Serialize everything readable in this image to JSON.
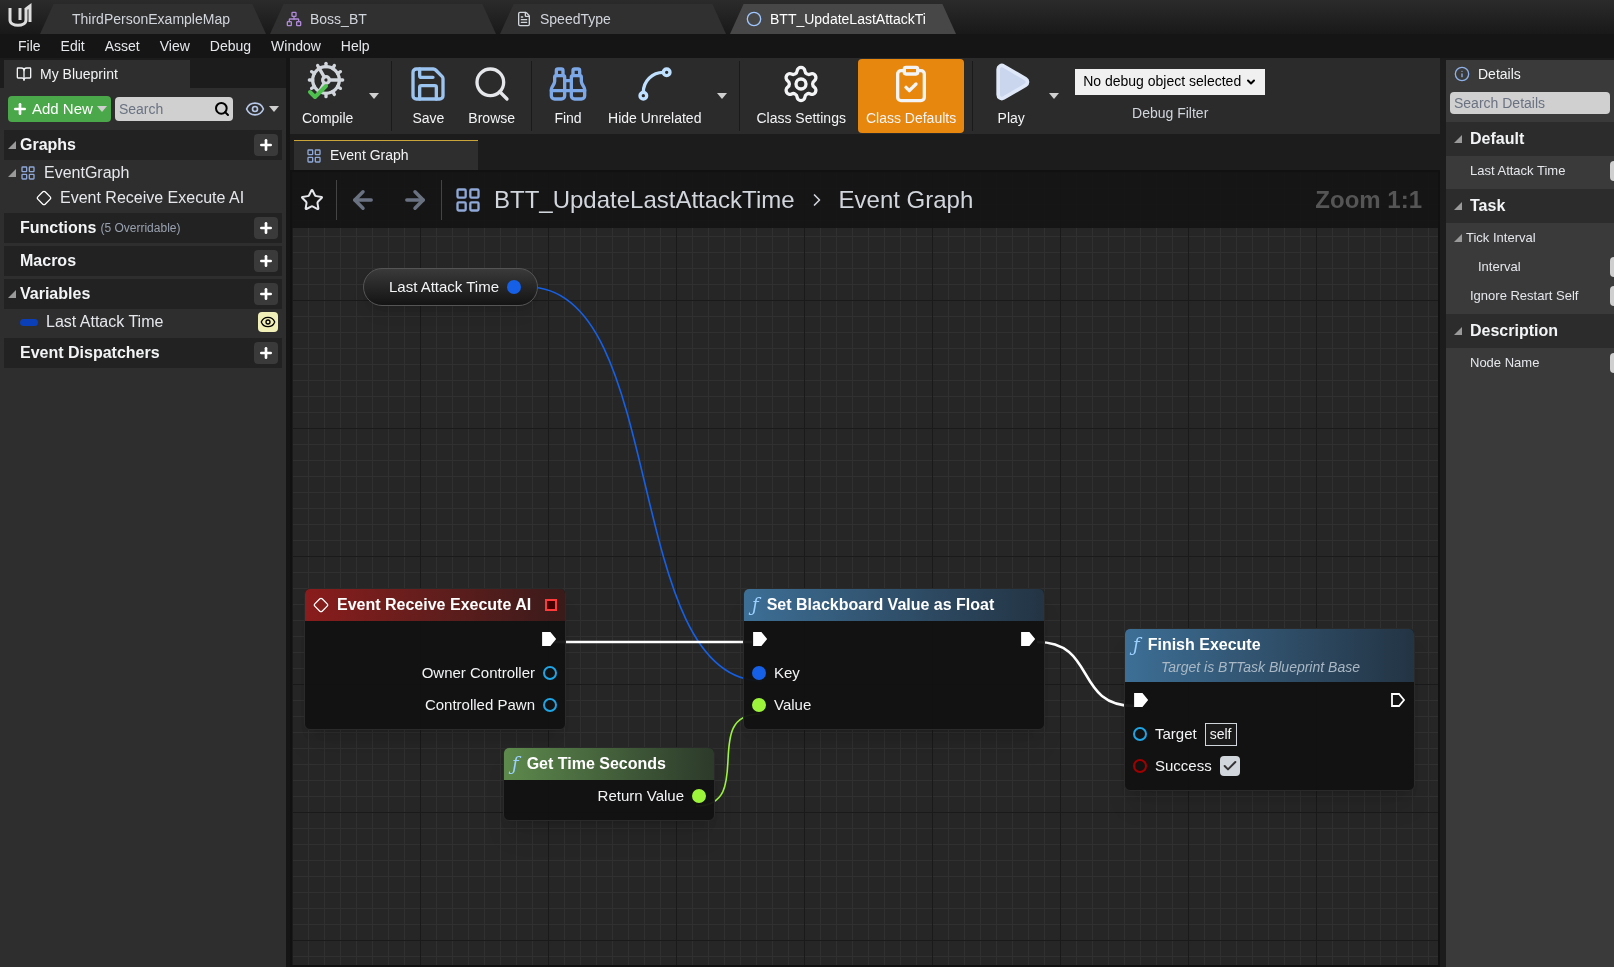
{
  "doc_tabs": [
    {
      "label": "ThirdPersonExampleMap",
      "kind": "map",
      "selected": false
    },
    {
      "label": "Boss_BT",
      "kind": "tree",
      "selected": false
    },
    {
      "label": "SpeedType",
      "kind": "struct",
      "selected": false
    },
    {
      "label": "BTT_UpdateLastAttackTi",
      "kind": "blueprint",
      "selected": true
    }
  ],
  "menu": [
    "File",
    "Edit",
    "Asset",
    "View",
    "Debug",
    "Window",
    "Help"
  ],
  "my_blueprint": {
    "title": "My Blueprint",
    "add_button": "Add New",
    "search_placeholder": "Search",
    "sections": [
      {
        "title": "Graphs",
        "expanded": true,
        "items": [
          {
            "label": "EventGraph",
            "kind": "graph",
            "expanded": true,
            "children": [
              {
                "label": "Event Receive Execute AI",
                "kind": "event"
              }
            ]
          }
        ]
      },
      {
        "title": "Functions",
        "note": "(5 Overridable)"
      },
      {
        "title": "Macros"
      },
      {
        "title": "Variables",
        "expanded": true,
        "items": [
          {
            "label": "Last Attack Time",
            "kind": "variable",
            "color": "#0b3fb8"
          }
        ]
      },
      {
        "title": "Event Dispatchers"
      }
    ]
  },
  "toolbar": [
    {
      "label": "Compile",
      "kind": "compile",
      "dropdown": true,
      "selected": false
    },
    {
      "label": "Save",
      "kind": "save",
      "dropdown": false,
      "selected": false
    },
    {
      "label": "Browse",
      "kind": "browse",
      "dropdown": false,
      "selected": false
    },
    {
      "label": "Find",
      "kind": "find",
      "dropdown": false,
      "selected": false
    },
    {
      "label": "Hide Unrelated",
      "kind": "hide",
      "dropdown": true,
      "selected": false
    },
    {
      "label": "Class Settings",
      "kind": "settings",
      "dropdown": false,
      "selected": false
    },
    {
      "label": "Class Defaults",
      "kind": "defaults",
      "dropdown": false,
      "selected": true
    },
    {
      "label": "Play",
      "kind": "play",
      "dropdown": true,
      "selected": false
    }
  ],
  "debug_filter": {
    "value": "No debug object selected",
    "label": "Debug Filter"
  },
  "graph_tab": "Event Graph",
  "breadcrumb": [
    "BTT_UpdateLastAttackTime",
    "Event Graph"
  ],
  "zoom": "Zoom 1:1",
  "nodes": [
    {
      "kind": "variable",
      "title": "Last Attack Time",
      "outputs": [
        {
          "kind": "name",
          "connected": true
        }
      ]
    },
    {
      "kind": "event",
      "title": "Event Receive Execute AI",
      "outputs": [
        {
          "kind": "exec",
          "connected": true
        },
        {
          "name": "Owner Controller",
          "kind": "object",
          "connected": false
        },
        {
          "name": "Controlled Pawn",
          "kind": "object",
          "connected": false
        }
      ]
    },
    {
      "kind": "function",
      "icon": "ƒ",
      "title": "Set Blackboard Value as Float",
      "inputs": [
        {
          "kind": "exec",
          "connected": true
        },
        {
          "name": "Key",
          "kind": "name",
          "connected": true
        },
        {
          "name": "Value",
          "kind": "float",
          "connected": true
        }
      ],
      "outputs": [
        {
          "kind": "exec",
          "connected": true
        }
      ]
    },
    {
      "kind": "function",
      "icon": "ƒ",
      "title": "Finish Execute",
      "subtitle": "Target is BTTask Blueprint Base",
      "inputs": [
        {
          "kind": "exec",
          "connected": true
        },
        {
          "name": "Target",
          "kind": "object",
          "connected": false,
          "value": "self"
        },
        {
          "name": "Success",
          "kind": "bool",
          "connected": false,
          "checked": true
        }
      ],
      "outputs": [
        {
          "kind": "exec",
          "connected": false
        }
      ]
    },
    {
      "kind": "pure",
      "icon": "ƒ",
      "title": "Get Time Seconds",
      "outputs": [
        {
          "name": "Return Value",
          "kind": "float",
          "connected": true
        }
      ]
    }
  ],
  "details": {
    "title": "Details",
    "search_placeholder": "Search Details",
    "categories": [
      {
        "title": "Default",
        "expanded": true,
        "rows": [
          {
            "label": "Last Attack Time"
          }
        ]
      },
      {
        "title": "Task",
        "expanded": true,
        "rows": [
          {
            "label": "Tick Interval",
            "expanded": true,
            "children": [
              {
                "label": "Interval"
              }
            ]
          },
          {
            "label": "Ignore Restart Self"
          }
        ]
      },
      {
        "title": "Description",
        "expanded": true,
        "rows": [
          {
            "label": "Node Name"
          }
        ]
      }
    ]
  }
}
